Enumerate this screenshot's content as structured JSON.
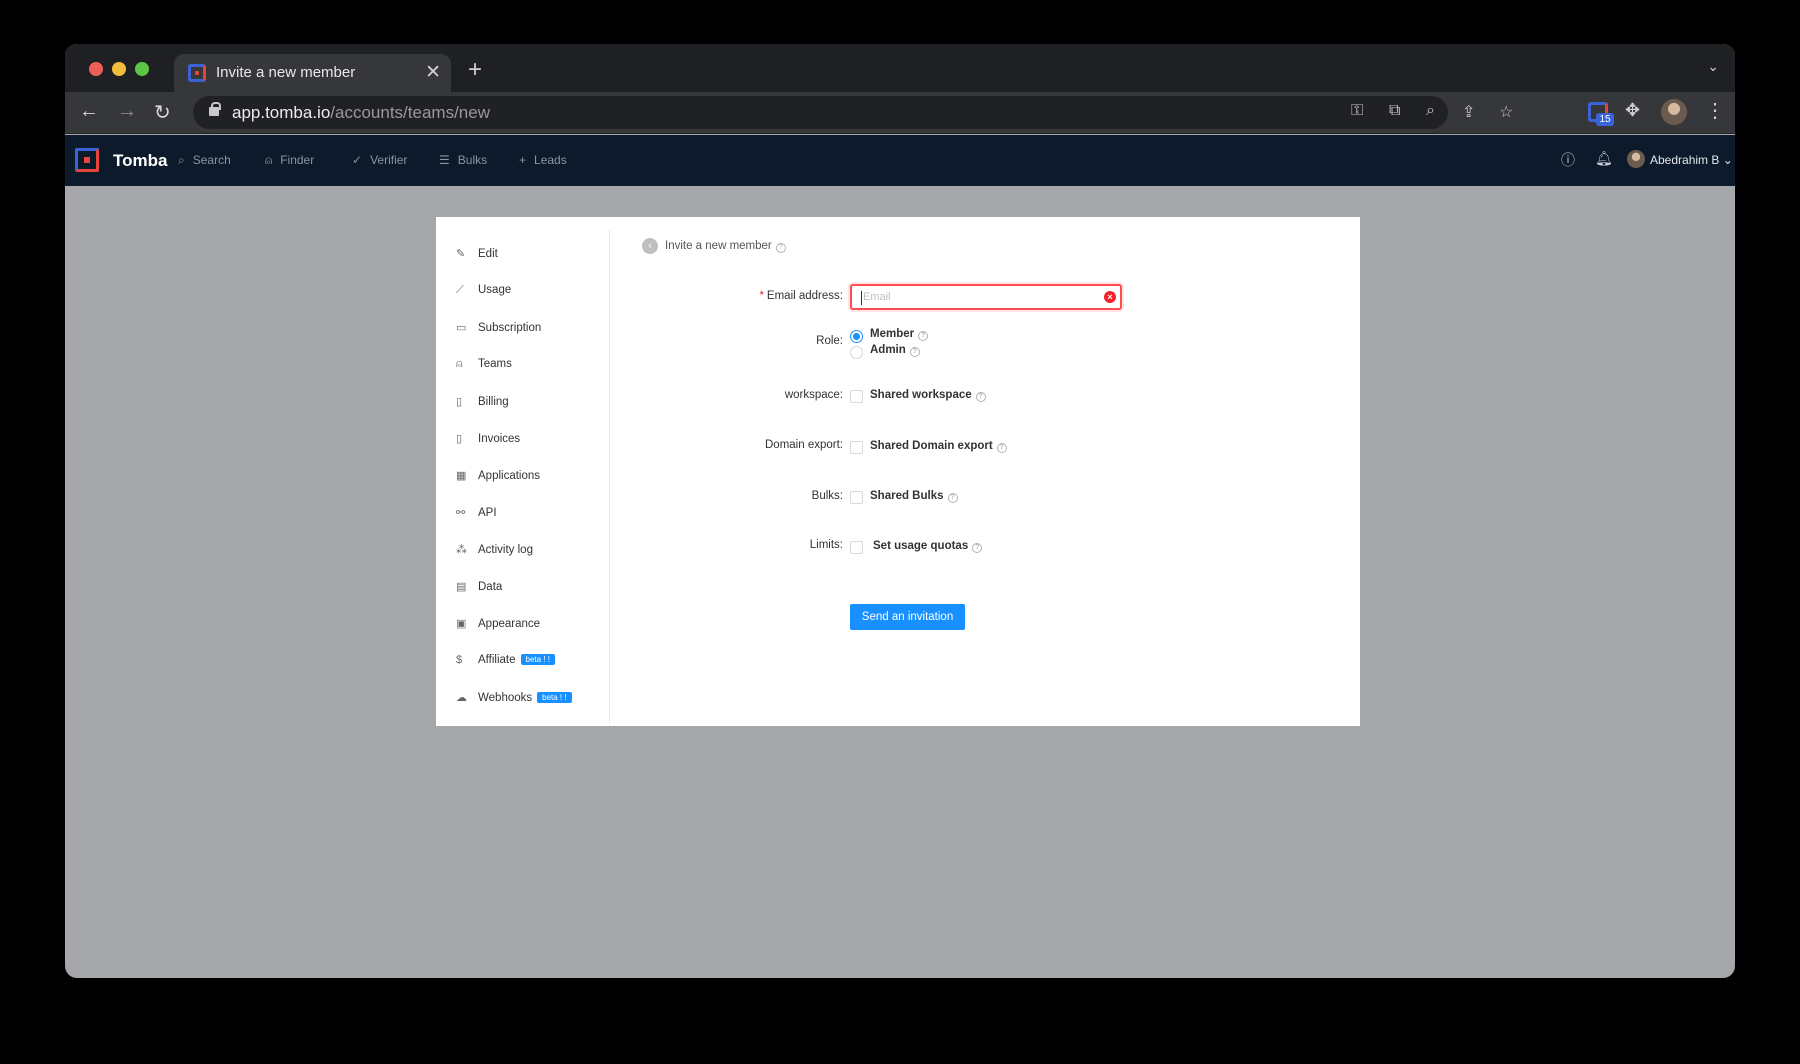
{
  "browser": {
    "tab_title": "Invite a new member",
    "url_host": "app.tomba.io",
    "url_path": "/accounts/teams/new",
    "extension_badge": "15"
  },
  "appnav": {
    "brand": "Tomba",
    "items": [
      {
        "label": "Search",
        "icon": "search-icon"
      },
      {
        "label": "Finder",
        "icon": "user-icon"
      },
      {
        "label": "Verifier",
        "icon": "check-icon"
      },
      {
        "label": "Bulks",
        "icon": "list-icon"
      },
      {
        "label": "Leads",
        "icon": "plus-icon"
      }
    ],
    "user_name": "Abedrahim B"
  },
  "sidebar": {
    "items": [
      {
        "label": "Edit",
        "icon": "edit-icon"
      },
      {
        "label": "Usage",
        "icon": "chart-icon"
      },
      {
        "label": "Subscription",
        "icon": "card-icon"
      },
      {
        "label": "Teams",
        "icon": "team-icon"
      },
      {
        "label": "Billing",
        "icon": "file-icon"
      },
      {
        "label": "Invoices",
        "icon": "document-icon"
      },
      {
        "label": "Applications",
        "icon": "apps-icon"
      },
      {
        "label": "API",
        "icon": "api-icon"
      },
      {
        "label": "Activity log",
        "icon": "activity-icon"
      },
      {
        "label": "Data",
        "icon": "database-icon"
      },
      {
        "label": "Appearance",
        "icon": "layout-icon"
      },
      {
        "label": "Affiliate",
        "icon": "dollar-icon",
        "badge": "beta ! !"
      },
      {
        "label": "Webhooks",
        "icon": "webhook-icon",
        "badge": "beta ! !"
      }
    ]
  },
  "form": {
    "title": "Invite a new member",
    "email_label": "Email address",
    "email_placeholder": "Email",
    "role_label": "Role",
    "role_options": [
      "Member",
      "Admin"
    ],
    "role_selected": "Member",
    "workspace_label": "workspace",
    "workspace_option": "Shared workspace",
    "domain_export_label": "Domain export",
    "domain_export_option": "Shared Domain export",
    "bulks_label": "Bulks",
    "bulks_option": "Shared Bulks",
    "limits_label": "Limits",
    "limits_option": "Set usage quotas",
    "submit_label": "Send an invitation"
  },
  "colors": {
    "primary": "#1890ff",
    "error": "#ff4d4f",
    "navbar": "#0d1a2b",
    "page_bg": "#a6a7ab"
  }
}
